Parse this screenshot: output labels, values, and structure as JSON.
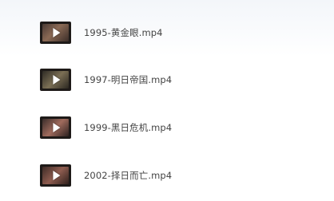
{
  "files": [
    {
      "name": "1995-黄金眼.mp4",
      "thumbnail_icon": "video-play-icon"
    },
    {
      "name": "1997-明日帝国.mp4",
      "thumbnail_icon": "video-play-icon"
    },
    {
      "name": "1999-黑日危机.mp4",
      "thumbnail_icon": "video-play-icon"
    },
    {
      "name": "2002-择日而亡.mp4",
      "thumbnail_icon": "video-play-icon"
    }
  ],
  "colors": {
    "text": "#444444",
    "background": "#ffffff",
    "play_icon": "#ffffff"
  }
}
